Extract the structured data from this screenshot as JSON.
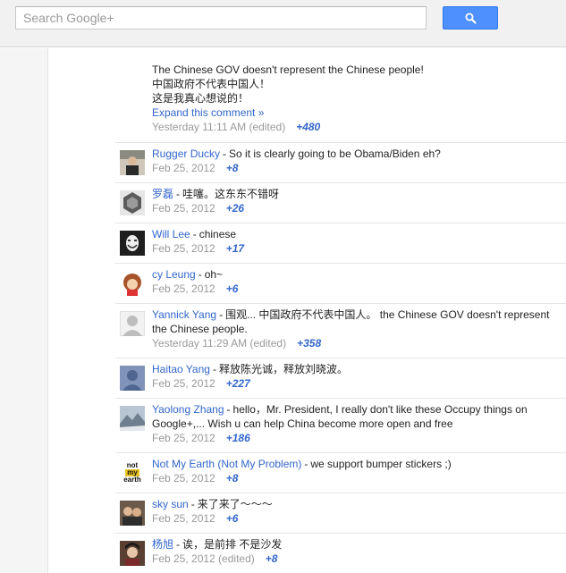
{
  "search": {
    "placeholder": "Search Google+"
  },
  "first_comment": {
    "lines": [
      "The Chinese GOV doesn't represent the Chinese people!",
      "中国政府不代表中国人！",
      "这是我真心想说的！"
    ],
    "expand_label": "Expand this comment »",
    "time": "Yesterday 11:11 AM (edited)",
    "plus": "+480"
  },
  "comments": [
    {
      "author": "Rugger Ducky",
      "text": "So it is clearly going to be Obama/Biden eh?",
      "time": "Feb 25, 2012",
      "plus": "+8"
    },
    {
      "author": "罗磊",
      "text": "哇噻。这东东不错呀",
      "time": "Feb 25, 2012",
      "plus": "+26"
    },
    {
      "author": "Will Lee",
      "text": "chinese",
      "time": "Feb 25, 2012",
      "plus": "+17"
    },
    {
      "author": "cy Leung",
      "text": "oh~",
      "time": "Feb 25, 2012",
      "plus": "+6"
    },
    {
      "author": "Yannick Yang",
      "text": "围观... 中国政府不代表中国人。 the Chinese GOV doesn't represent",
      "text2": "the Chinese people.",
      "time": "Yesterday 11:29 AM (edited)",
      "plus": "+358"
    },
    {
      "author": "Haitao Yang",
      "text": "释放陈光诚，释放刘晓波。",
      "time": "Feb 25, 2012",
      "plus": "+227"
    },
    {
      "author": "Yaolong Zhang",
      "text": "hello，Mr. President, I really don't like these Occupy things on",
      "text2": "Google+,... Wish u can help China become more open and free",
      "time": "Feb 25, 2012",
      "plus": "+186"
    },
    {
      "author": "Not My Earth (Not My Problem)",
      "text": "we support bumper stickers ;)",
      "time": "Feb 25, 2012",
      "plus": "+8",
      "avatar_text": [
        "not",
        "my",
        "earth"
      ]
    },
    {
      "author": "sky sun",
      "text": "来了来了～～～",
      "time": "Feb 25, 2012",
      "plus": "+6"
    },
    {
      "author": "杨旭",
      "text": "诶，是前排 不是沙发",
      "time": "Feb 25, 2012 (edited)",
      "plus": "+8"
    }
  ],
  "separator": "-",
  "colors": {
    "link": "#3366cc",
    "meta": "#999999",
    "search_button": "#4d90fe"
  }
}
